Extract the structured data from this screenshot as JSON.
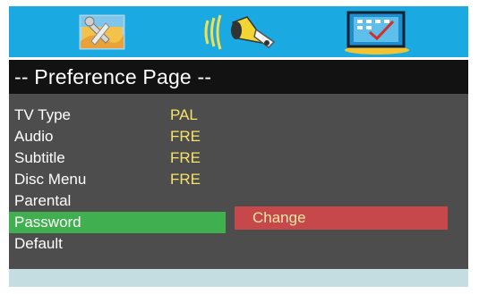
{
  "header": {
    "icons": [
      "general-setup-icon",
      "audio-setup-icon",
      "preference-setup-icon"
    ],
    "title": "-- Preference Page --"
  },
  "menu": {
    "items": [
      {
        "label": "TV Type",
        "value": "PAL"
      },
      {
        "label": "Audio",
        "value": "FRE"
      },
      {
        "label": "Subtitle",
        "value": "FRE"
      },
      {
        "label": "Disc Menu",
        "value": "FRE"
      },
      {
        "label": "Parental",
        "value": ""
      },
      {
        "label": "Password",
        "value": ""
      },
      {
        "label": "Default",
        "value": ""
      }
    ],
    "selected_index": 5
  },
  "submenu": {
    "option": "Change"
  },
  "colors": {
    "header_bg": "#1aa9e1",
    "title_bg": "#121212",
    "content_bg": "#4d4d4d",
    "selected_bg": "#3faf4f",
    "option_bg": "#c6484a",
    "value_text": "#f6e36a",
    "footer_bg": "#c3dde0"
  }
}
